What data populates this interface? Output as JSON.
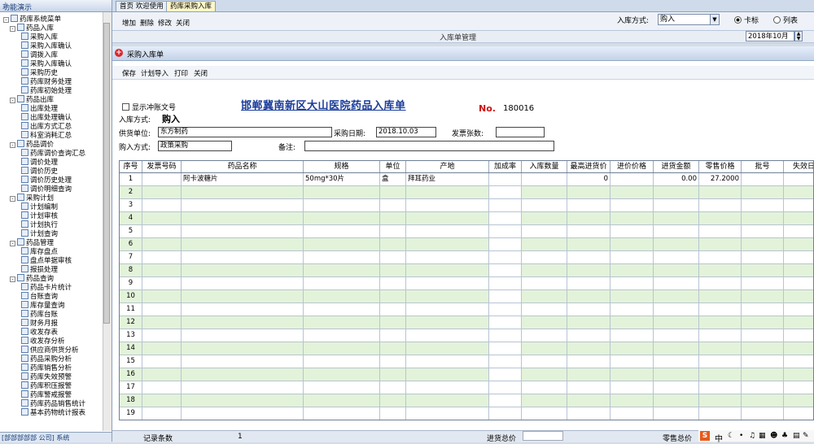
{
  "left_panel": {
    "title": "功能演示",
    "footer": "[部部部部部 公司] 系统",
    "tree": [
      {
        "level": 0,
        "label": "药库系统菜单",
        "toggle": "-"
      },
      {
        "level": 1,
        "label": "药品入库",
        "toggle": "-"
      },
      {
        "level": 2,
        "label": "采购入库"
      },
      {
        "level": 2,
        "label": "采购入库确认"
      },
      {
        "level": 2,
        "label": "调拨入库"
      },
      {
        "level": 2,
        "label": "采购入库确认"
      },
      {
        "level": 2,
        "label": "采购历史"
      },
      {
        "level": 2,
        "label": "药库财务处理"
      },
      {
        "level": 2,
        "label": "药库初始处理"
      },
      {
        "level": 1,
        "label": "药品出库",
        "toggle": "-"
      },
      {
        "level": 2,
        "label": "出库处理"
      },
      {
        "level": 2,
        "label": "出库处理确认"
      },
      {
        "level": 2,
        "label": "出库方式汇总"
      },
      {
        "level": 2,
        "label": "科室消耗汇总"
      },
      {
        "level": 1,
        "label": "药品调价",
        "toggle": "-"
      },
      {
        "level": 2,
        "label": "药库调价查询汇总"
      },
      {
        "level": 2,
        "label": "调价处理"
      },
      {
        "level": 2,
        "label": "调价历史"
      },
      {
        "level": 2,
        "label": "调价历史处理"
      },
      {
        "level": 2,
        "label": "调价明细查询"
      },
      {
        "level": 1,
        "label": "采购计划",
        "toggle": "-"
      },
      {
        "level": 2,
        "label": "计划编制"
      },
      {
        "level": 2,
        "label": "计划审核"
      },
      {
        "level": 2,
        "label": "计划执行"
      },
      {
        "level": 2,
        "label": "计划查询"
      },
      {
        "level": 1,
        "label": "药品管理",
        "toggle": "-"
      },
      {
        "level": 2,
        "label": "库存盘点"
      },
      {
        "level": 2,
        "label": "盘点单据审核"
      },
      {
        "level": 2,
        "label": "报损处理"
      },
      {
        "level": 1,
        "label": "药品查询",
        "toggle": "-"
      },
      {
        "level": 2,
        "label": "药品卡片统计"
      },
      {
        "level": 2,
        "label": "台账查询"
      },
      {
        "level": 2,
        "label": "库存量查询"
      },
      {
        "level": 2,
        "label": "药库台账"
      },
      {
        "level": 2,
        "label": "财务月报"
      },
      {
        "level": 2,
        "label": "收发存表"
      },
      {
        "level": 2,
        "label": "收发存分析"
      },
      {
        "level": 2,
        "label": "供应商供货分析"
      },
      {
        "level": 2,
        "label": "药品采购分析"
      },
      {
        "level": 2,
        "label": "药库销售分析"
      },
      {
        "level": 2,
        "label": "药库失效预警"
      },
      {
        "level": 2,
        "label": "药库积压报警"
      },
      {
        "level": 2,
        "label": "药库警戒报警"
      },
      {
        "level": 2,
        "label": "药库药品销售统计"
      },
      {
        "level": 2,
        "label": "基本药物统计报表"
      }
    ]
  },
  "tabs": [
    {
      "label": "首页 欢迎使用",
      "active": false
    },
    {
      "label": "药库采购入库",
      "active": true
    }
  ],
  "toolbar1": {
    "buttons": [
      "增加",
      "删除",
      "修改",
      "关闭"
    ],
    "ruku_label": "入库方式:",
    "ruku_value": "购入",
    "radio1": "卡标",
    "radio2": "列表"
  },
  "manage_title": "入库单管理",
  "date_value": "2018年10月",
  "inner": {
    "title": "采购入库单",
    "toolbar": [
      "保存",
      "计划导入",
      "打印",
      "关闭"
    ],
    "show_label": "显示冲账文号",
    "form_title": "邯郸冀南新区大山医院药品入库单",
    "no_label": "No.",
    "no_value": "180016",
    "inmode_label": "入库方式:",
    "inmode_value": "购入",
    "supplier_label": "供货单位:",
    "supplier_value": "东方制药",
    "date_label": "采购日期:",
    "date_value": "2018.10.03",
    "invoice_label": "发票张数:",
    "invoice_value": "",
    "buymode_label": "购入方式:",
    "buymode_value": "政策采购",
    "remark_label": "备注:",
    "remark_value": ""
  },
  "grid": {
    "columns": [
      "序号",
      "发票号码",
      "药品名称",
      "规格",
      "单位",
      "产地",
      "加成率",
      "入库数量",
      "最高进货价",
      "进价价格",
      "进货金额",
      "零售价格",
      "批号",
      "失效日"
    ],
    "rows": [
      {
        "no": "1",
        "name": "阿卡波糖片",
        "spec": "50mg*30片",
        "unit": "盒",
        "origin": "拜耳药业",
        "max_price": "0",
        "amount": "0.00",
        "retail": "27.2000"
      },
      {
        "no": "2"
      },
      {
        "no": "3"
      },
      {
        "no": "4"
      },
      {
        "no": "5"
      },
      {
        "no": "6"
      },
      {
        "no": "7"
      },
      {
        "no": "8"
      },
      {
        "no": "9"
      },
      {
        "no": "10"
      },
      {
        "no": "11"
      },
      {
        "no": "12"
      },
      {
        "no": "13"
      },
      {
        "no": "14"
      },
      {
        "no": "15"
      },
      {
        "no": "16"
      },
      {
        "no": "17"
      },
      {
        "no": "18"
      },
      {
        "no": "19"
      }
    ]
  },
  "footer": {
    "record_label": "记录条数",
    "record_count": "1",
    "total_label": "进货总价",
    "retail_label": "零售总价"
  },
  "tray": {
    "ime": "S",
    "lang": "中"
  },
  "colors": {
    "row_alt": "#e3f3d9",
    "title_blue": "#1a3c9a",
    "no_red": "#d01010"
  }
}
